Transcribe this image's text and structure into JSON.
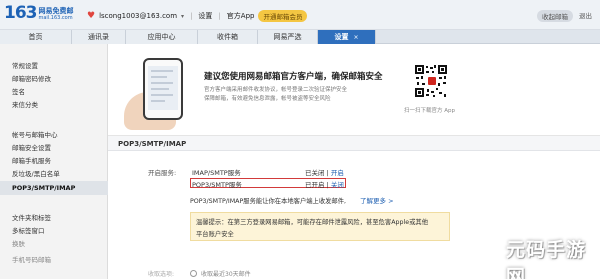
{
  "header": {
    "logo_number": "163",
    "logo_name": "网易免费邮",
    "logo_domain": "mail.163.com",
    "account_email": "lscong1003@163.com",
    "settings_link": "设置",
    "app_link": "官方App",
    "vip_label": "开通邮箱会员",
    "right_links": [
      "收起邮箱",
      "退出"
    ]
  },
  "tabs": [
    {
      "label": "首页"
    },
    {
      "label": "通讯录"
    },
    {
      "label": "应用中心"
    },
    {
      "label": "收件箱"
    },
    {
      "label": "网易严选"
    },
    {
      "label": "设置",
      "close": "×"
    }
  ],
  "sidebar": {
    "items": [
      {
        "label": "常规设置"
      },
      {
        "label": "邮箱密码修改"
      },
      {
        "label": "签名"
      },
      {
        "label": "来信分类"
      },
      {
        "label": "帐号与邮箱中心"
      },
      {
        "label": "邮箱安全设置"
      },
      {
        "label": "邮箱手机服务"
      },
      {
        "label": "反垃圾/黑白名单"
      },
      {
        "label": "POP3/SMTP/IMAP"
      },
      {
        "label": "文件夹和标签"
      },
      {
        "label": "多标签窗口"
      },
      {
        "label": "换肤"
      },
      {
        "label": "手机号码邮箱"
      }
    ]
  },
  "banner": {
    "title": "建议您使用网易邮箱官方客户端，确保邮箱安全",
    "line1": "官方客户端采用邮件收发协议，帐号登录二次验证保护安全",
    "line2": "保障邮箱，有效避免信息泄露，帐号被盗等安全风险",
    "qr_caption": "扫一扫下载官方 App"
  },
  "section": {
    "title": "POP3/SMTP/IMAP",
    "open_service_label": "开启服务:",
    "services": [
      {
        "name": "IMAP/SMTP服务",
        "status": "已关闭",
        "action": "开启"
      },
      {
        "name": "POP3/SMTP服务",
        "status": "已开启",
        "action": "关闭"
      }
    ],
    "note": "POP3/SMTP/IMAP服务能让你在本地客户端上收发邮件,",
    "more_link": "了解更多 >",
    "tip_line1": "温馨提示：在第三方登录网易邮箱，可能存在邮件泄露风险，甚至危害Apple或其他",
    "tip_line2": "平台账户安全",
    "receive_label": "收取选项:",
    "radio_label": "收取最近30天邮件"
  },
  "watermark": "元码手游网"
}
